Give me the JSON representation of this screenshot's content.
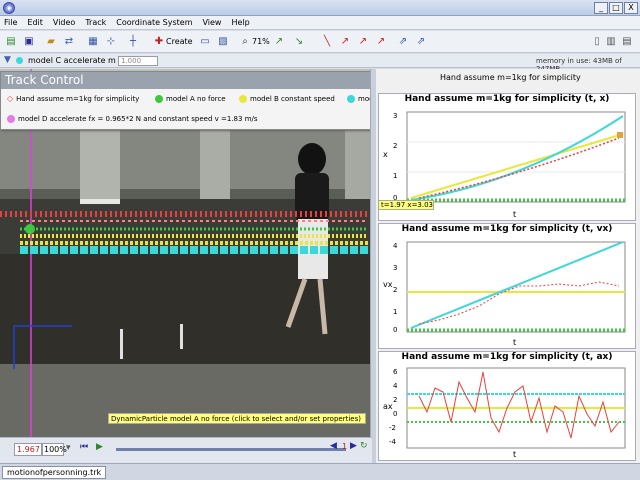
{
  "window": {
    "minimize": "_",
    "maximize": "□",
    "close": "X"
  },
  "menu": [
    "File",
    "Edit",
    "Video",
    "Track",
    "Coordinate System",
    "View",
    "Help"
  ],
  "toolbar": {
    "create_label": "Create",
    "zoom_label": "71%"
  },
  "trackbar": {
    "model_name": "model C accelerate",
    "mass_label": "m",
    "mass_value": "1.000",
    "memory": "memory in use: 43MB of 247MB"
  },
  "track_control": {
    "title": "Track Control",
    "items": [
      {
        "label": "Hand assume m=1kg for simplicity",
        "color": "#e8403c"
      },
      {
        "label": "model A no force",
        "color": "#3ec83e"
      },
      {
        "label": "model B constant speed",
        "color": "#e8e83c"
      },
      {
        "label": "model C accelerate",
        "color": "#3cd8d8"
      },
      {
        "label": "model D accelerate fx = 0.965*2 N and constant speed v =1.83 m/s",
        "color": "#e87ae8"
      }
    ]
  },
  "plots": {
    "header": "Hand assume m=1kg for simplicity",
    "p1": {
      "title": "Hand assume m=1kg for simplicity (t, x)",
      "ylabel": "x",
      "xlabel": "t",
      "yticks": [
        "3",
        "2",
        "1",
        "0"
      ]
    },
    "p2": {
      "title": "Hand assume m=1kg for simplicity (t, vx)",
      "ylabel": "vx",
      "xlabel": "t",
      "yticks": [
        "4",
        "3",
        "2",
        "1",
        "0"
      ]
    },
    "p3": {
      "title": "Hand assume m=1kg for simplicity (t, ax)",
      "ylabel": "ax",
      "xlabel": "t",
      "yticks": [
        "6",
        "4",
        "2",
        "0",
        "-2",
        "-4"
      ]
    },
    "xticks": [
      "0",
      "0.2",
      "0.4",
      "0.6",
      "0.8",
      "1",
      "1.2",
      "1.4",
      "1.6",
      "1.8"
    ]
  },
  "readout": "t=1.97  x=3.03",
  "video": {
    "dynamic_label": "DynamicParticle model A no force (click to select and/or set properties)"
  },
  "controls": {
    "frame_time": "1.967",
    "zoom": "100%",
    "step": "1"
  },
  "file_tab": "motionofpersonning.trk"
}
